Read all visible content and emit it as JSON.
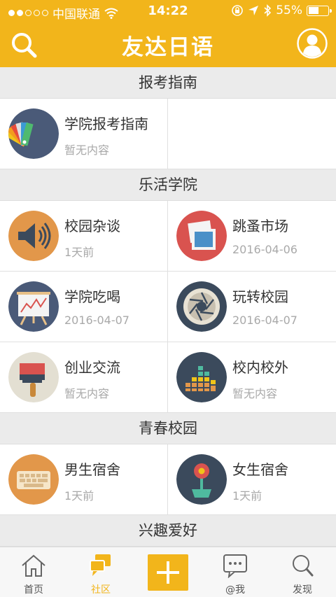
{
  "status_bar": {
    "carrier": "中国联通",
    "time": "14:22",
    "battery": "55%",
    "battery_level": 0.55
  },
  "header": {
    "title": "友达日语"
  },
  "sections": [
    {
      "title": "报考指南",
      "rows": [
        [
          {
            "name": "学院报考指南",
            "sub": "暂无内容",
            "icon": "palette-icon"
          },
          null
        ]
      ]
    },
    {
      "title": "乐活学院",
      "rows": [
        [
          {
            "name": "校园杂谈",
            "sub": "1天前",
            "icon": "speaker-icon"
          },
          {
            "name": "跳蚤市场",
            "sub": "2016-04-06",
            "icon": "photos-icon"
          }
        ],
        [
          {
            "name": "学院吃喝",
            "sub": "2016-04-07",
            "icon": "easel-chart-icon"
          },
          {
            "name": "玩转校园",
            "sub": "2016-04-07",
            "icon": "aperture-icon"
          }
        ],
        [
          {
            "name": "创业交流",
            "sub": "暂无内容",
            "icon": "paint-brush-icon"
          },
          {
            "name": "校内校外",
            "sub": "暂无内容",
            "icon": "equalizer-icon"
          }
        ]
      ]
    },
    {
      "title": "青春校园",
      "rows": [
        [
          {
            "name": "男生宿舍",
            "sub": "1天前",
            "icon": "keyboard-icon"
          },
          {
            "name": "女生宿舍",
            "sub": "1天前",
            "icon": "flower-icon"
          }
        ]
      ]
    },
    {
      "title": "兴趣爱好",
      "rows": []
    }
  ],
  "tabs": [
    {
      "label": "首页",
      "icon": "home-icon"
    },
    {
      "label": "社区",
      "icon": "chat-bubbles-icon",
      "active": true
    },
    {
      "label": "",
      "icon": "plus-icon"
    },
    {
      "label": "@我",
      "icon": "message-icon"
    },
    {
      "label": "发现",
      "icon": "discover-search-icon"
    }
  ],
  "colors": {
    "brand": "#f2b51b",
    "section_bg": "#ebebeb",
    "subtext": "#a9a9a9"
  }
}
